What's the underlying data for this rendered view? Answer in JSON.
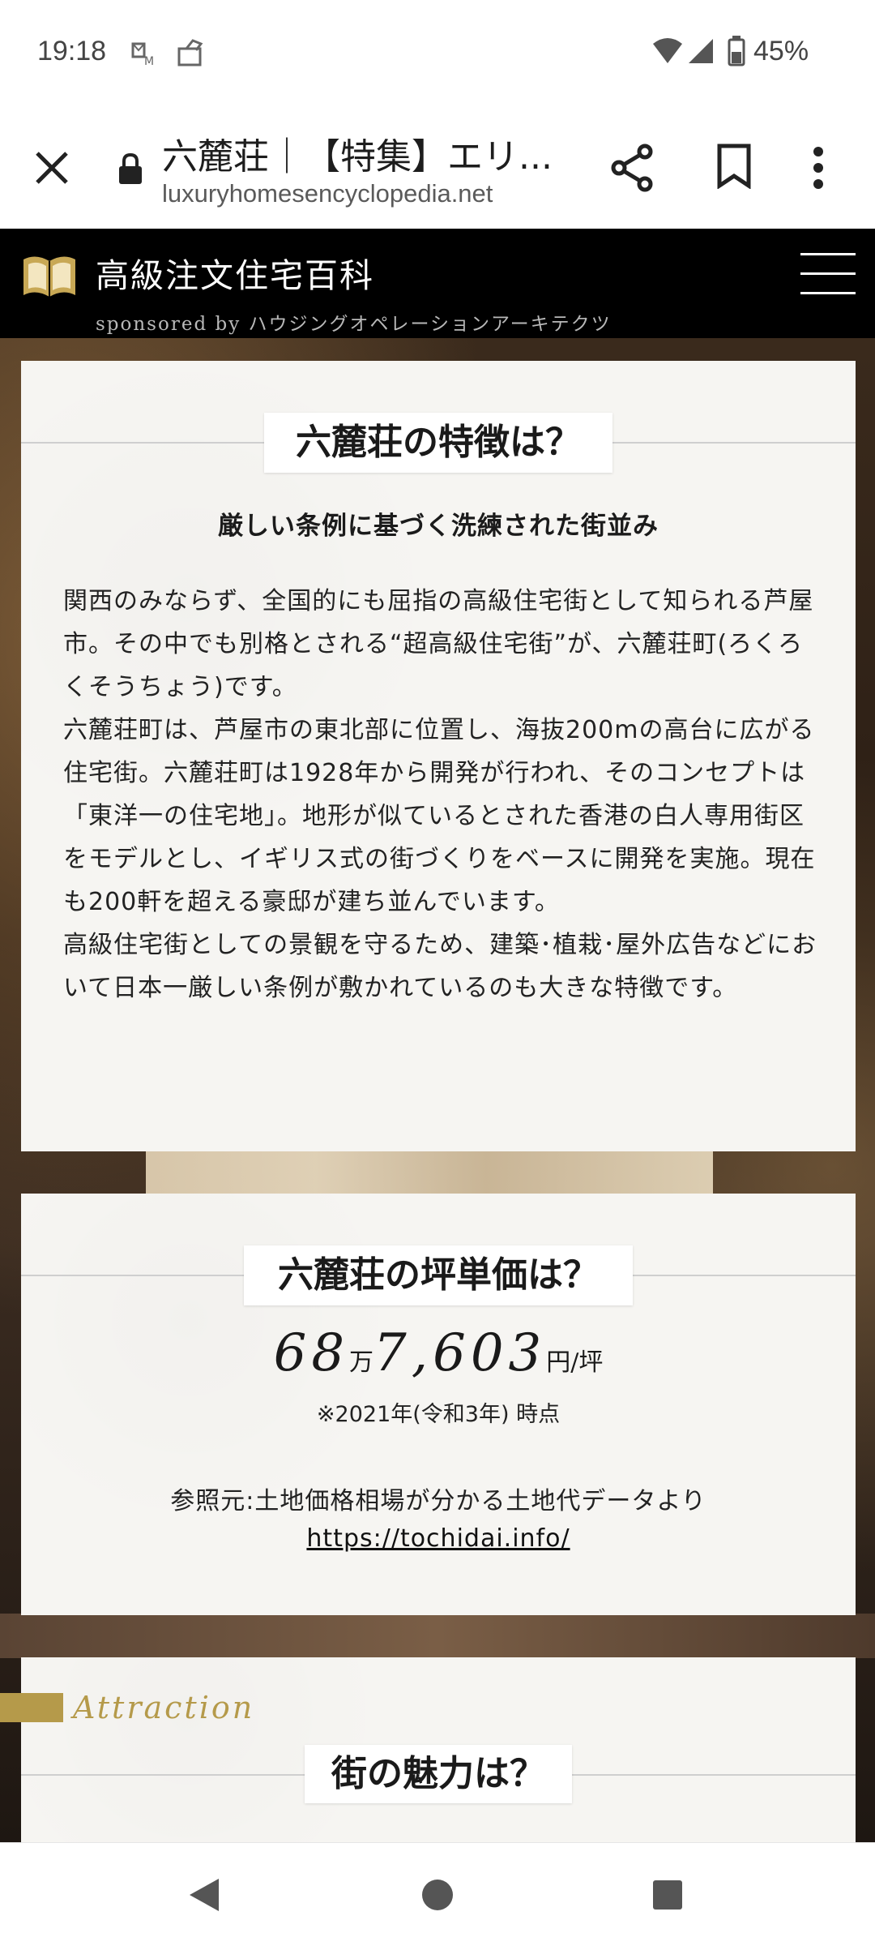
{
  "status_bar": {
    "time": "19:18",
    "battery": "45%",
    "icons": [
      "voicemail-icon",
      "notification-icon",
      "wifi-icon",
      "signal-icon",
      "battery-icon"
    ]
  },
  "browser": {
    "tab_title": "六麓荘｜【特集】エリ...",
    "url": "luxuryhomesencyclopedia.net",
    "icons": [
      "close-icon",
      "lock-icon",
      "share-icon",
      "bookmark-icon",
      "more-vert-icon"
    ]
  },
  "site_header": {
    "title": "高級注文住宅百科",
    "sponsor": "sponsored by ハウジングオペレーションアーキテクツ",
    "icons": [
      "book-logo-icon",
      "hamburger-menu-icon"
    ]
  },
  "section_features": {
    "heading": "六麓荘の特徴は？",
    "subheading": "厳しい条例に基づく洗練された街並み",
    "paragraphs": [
      "関西のみならず、全国的にも屈指の高級住宅街として知られる芦屋市。その中でも別格とされる“超高級住宅街”が、六麓荘町(ろくろくそうちょう)です。",
      "六麓荘町は、芦屋市の東北部に位置し、海抜200mの高台に広がる住宅街。六麓荘町は1928年から開発が行われ、そのコンセプトは「東洋一の住宅地」。地形が似ているとされた香港の白人専用街区をモデルとし、イギリス式の街づくりをベースに開発を実施。現在も200軒を超える豪邸が建ち並んでいます。",
      "高級住宅街としての景観を守るため、建築･植栽･屋外広告などにおいて日本一厳しい条例が敷かれているのも大きな特徴です。"
    ]
  },
  "section_price": {
    "heading": "六麓荘の坪単価は？",
    "price_man": "68",
    "unit_man": "万",
    "price_rest": "7,603",
    "unit_yen": "円/坪",
    "note": "※2021年(令和3年) 時点",
    "reference": "参照元:土地価格相場が分かる土地代データより",
    "reference_link": "https://tochidai.info/"
  },
  "section_attraction": {
    "label": "Attraction",
    "heading": "街の魅力は？"
  },
  "nav_bar": {
    "icons": [
      "back-icon",
      "home-icon",
      "recents-icon"
    ]
  },
  "colors": {
    "accent_gold": "#b59a4a",
    "header_bg": "#000000",
    "card_bg": "#f6f5f2"
  }
}
